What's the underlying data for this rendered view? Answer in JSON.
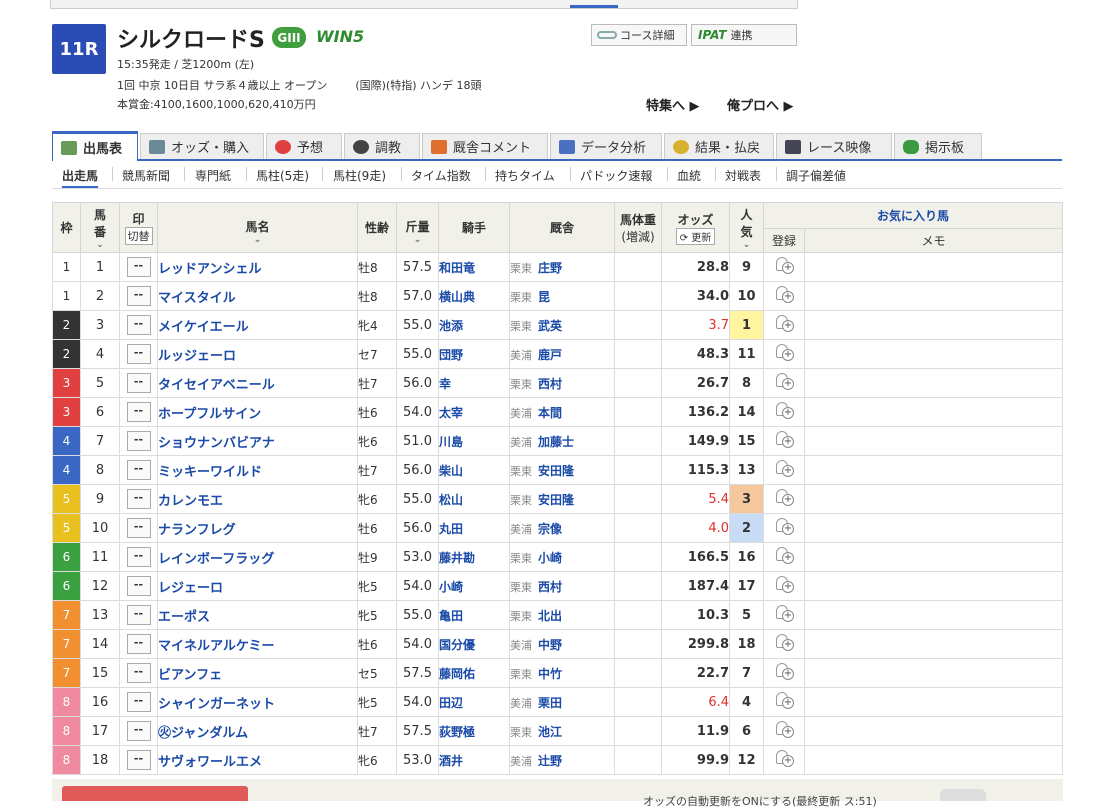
{
  "race": {
    "number": "11R",
    "name": "シルクロードS",
    "grade": "GIII",
    "win5": "WIN5",
    "line1": "15:35発走 / 芝1200m (左)",
    "line2a": "1回 中京 10日目 サラ系４歳以上 オープン",
    "line2b": "(国際)(特指) ハンデ 18頭",
    "line3": "本賞金:4100,1600,1000,620,410万円"
  },
  "buttons": {
    "course": "コース詳細",
    "ipat_logo": "IPAT",
    "ipat": "連携",
    "feature": "特集へ ▶",
    "pro": "俺プロへ ▶"
  },
  "tabs": [
    "出馬表",
    "オッズ・購入",
    "予想",
    "調教",
    "厩舎コメント",
    "データ分析",
    "結果・払戻",
    "レース映像",
    "掲示板"
  ],
  "subnav": [
    "出走馬",
    "競馬新聞",
    "専門紙",
    "馬柱(5走)",
    "馬柱(9走)",
    "タイム指数",
    "持ちタイム",
    "パドック速報",
    "血統",
    "対戦表",
    "調子偏差値"
  ],
  "table": {
    "headers": {
      "waku": "枠",
      "umaban_1": "馬",
      "umaban_2": "番",
      "mark": "印",
      "mark_toggle": "切替",
      "name": "馬名",
      "sexage": "性齢",
      "kinryo": "斤量",
      "jockey": "騎手",
      "trainer": "厩舎",
      "weight_1": "馬体重",
      "weight_2": "(増減)",
      "odds": "オッズ",
      "odds_update": "更新",
      "pop_1": "人",
      "pop_2": "気",
      "fav": "お気に入り馬",
      "reg": "登録",
      "memo": "メモ"
    },
    "mark_placeholder": "--",
    "rows": [
      {
        "waku": "1",
        "num": "1",
        "name": "レッドアンシェル",
        "sex": "牡8",
        "kin": "57.5",
        "jockey": "和田竜",
        "area": "栗東",
        "trainer": "庄野",
        "odds": "28.8",
        "pop": "9"
      },
      {
        "waku": "1",
        "num": "2",
        "name": "マイスタイル",
        "sex": "牡8",
        "kin": "57.0",
        "jockey": "横山典",
        "area": "栗東",
        "trainer": "昆",
        "odds": "34.0",
        "pop": "10"
      },
      {
        "waku": "2",
        "num": "3",
        "name": "メイケイエール",
        "sex": "牝4",
        "kin": "55.0",
        "jockey": "池添",
        "area": "栗東",
        "trainer": "武英",
        "odds": "3.7",
        "pop": "1"
      },
      {
        "waku": "2",
        "num": "4",
        "name": "ルッジェーロ",
        "sex": "セ7",
        "kin": "55.0",
        "jockey": "団野",
        "area": "美浦",
        "trainer": "鹿戸",
        "odds": "48.3",
        "pop": "11"
      },
      {
        "waku": "3",
        "num": "5",
        "name": "タイセイアベニール",
        "sex": "牡7",
        "kin": "56.0",
        "jockey": "幸",
        "area": "栗東",
        "trainer": "西村",
        "odds": "26.7",
        "pop": "8"
      },
      {
        "waku": "3",
        "num": "6",
        "name": "ホープフルサイン",
        "sex": "牡6",
        "kin": "54.0",
        "jockey": "太宰",
        "area": "美浦",
        "trainer": "本間",
        "odds": "136.2",
        "pop": "14"
      },
      {
        "waku": "4",
        "num": "7",
        "name": "ショウナンバビアナ",
        "sex": "牝6",
        "kin": "51.0",
        "jockey": "川島",
        "area": "美浦",
        "trainer": "加藤士",
        "odds": "149.9",
        "pop": "15"
      },
      {
        "waku": "4",
        "num": "8",
        "name": "ミッキーワイルド",
        "sex": "牡7",
        "kin": "56.0",
        "jockey": "柴山",
        "area": "栗東",
        "trainer": "安田隆",
        "odds": "115.3",
        "pop": "13"
      },
      {
        "waku": "5",
        "num": "9",
        "name": "カレンモエ",
        "sex": "牝6",
        "kin": "55.0",
        "jockey": "松山",
        "area": "栗東",
        "trainer": "安田隆",
        "odds": "5.4",
        "pop": "3"
      },
      {
        "waku": "5",
        "num": "10",
        "name": "ナランフレグ",
        "sex": "牡6",
        "kin": "56.0",
        "jockey": "丸田",
        "area": "美浦",
        "trainer": "宗像",
        "odds": "4.0",
        "pop": "2"
      },
      {
        "waku": "6",
        "num": "11",
        "name": "レインボーフラッグ",
        "sex": "牡9",
        "kin": "53.0",
        "jockey": "藤井勘",
        "area": "栗東",
        "trainer": "小崎",
        "odds": "166.5",
        "pop": "16"
      },
      {
        "waku": "6",
        "num": "12",
        "name": "レジェーロ",
        "sex": "牝5",
        "kin": "54.0",
        "jockey": "小崎",
        "area": "栗東",
        "trainer": "西村",
        "odds": "187.4",
        "pop": "17"
      },
      {
        "waku": "7",
        "num": "13",
        "name": "エーポス",
        "sex": "牝5",
        "kin": "55.0",
        "jockey": "亀田",
        "area": "栗東",
        "trainer": "北出",
        "odds": "10.3",
        "pop": "5"
      },
      {
        "waku": "7",
        "num": "14",
        "name": "マイネルアルケミー",
        "sex": "牡6",
        "kin": "54.0",
        "jockey": "国分優",
        "area": "美浦",
        "trainer": "中野",
        "odds": "299.8",
        "pop": "18"
      },
      {
        "waku": "7",
        "num": "15",
        "name": "ビアンフェ",
        "sex": "セ5",
        "kin": "57.5",
        "jockey": "藤岡佑",
        "area": "栗東",
        "trainer": "中竹",
        "odds": "22.7",
        "pop": "7"
      },
      {
        "waku": "8",
        "num": "16",
        "name": "シャインガーネット",
        "sex": "牝5",
        "kin": "54.0",
        "jockey": "田辺",
        "area": "美浦",
        "trainer": "栗田",
        "odds": "6.4",
        "pop": "4"
      },
      {
        "waku": "8",
        "num": "17",
        "name": "㊋ジャンダルム",
        "sex": "牡7",
        "kin": "57.5",
        "jockey": "荻野極",
        "area": "栗東",
        "trainer": "池江",
        "odds": "11.9",
        "pop": "6"
      },
      {
        "waku": "8",
        "num": "18",
        "name": "サヴォワールエメ",
        "sex": "牝6",
        "kin": "53.0",
        "jockey": "酒井",
        "area": "美浦",
        "trainer": "辻野",
        "odds": "99.9",
        "pop": "12"
      }
    ]
  },
  "footer": {
    "toggle_text": "オッズの自動更新をONにする(最終更新 ス:51)"
  },
  "colors": {
    "waku": {
      "1": "#ffffff",
      "2": "#333333",
      "3": "#e04040",
      "4": "#3a66c4",
      "5": "#e8c020",
      "6": "#3aa040",
      "7": "#f09030",
      "8": "#f08aa0"
    },
    "accent": "#3a66c4",
    "link": "#1a4aa8"
  }
}
